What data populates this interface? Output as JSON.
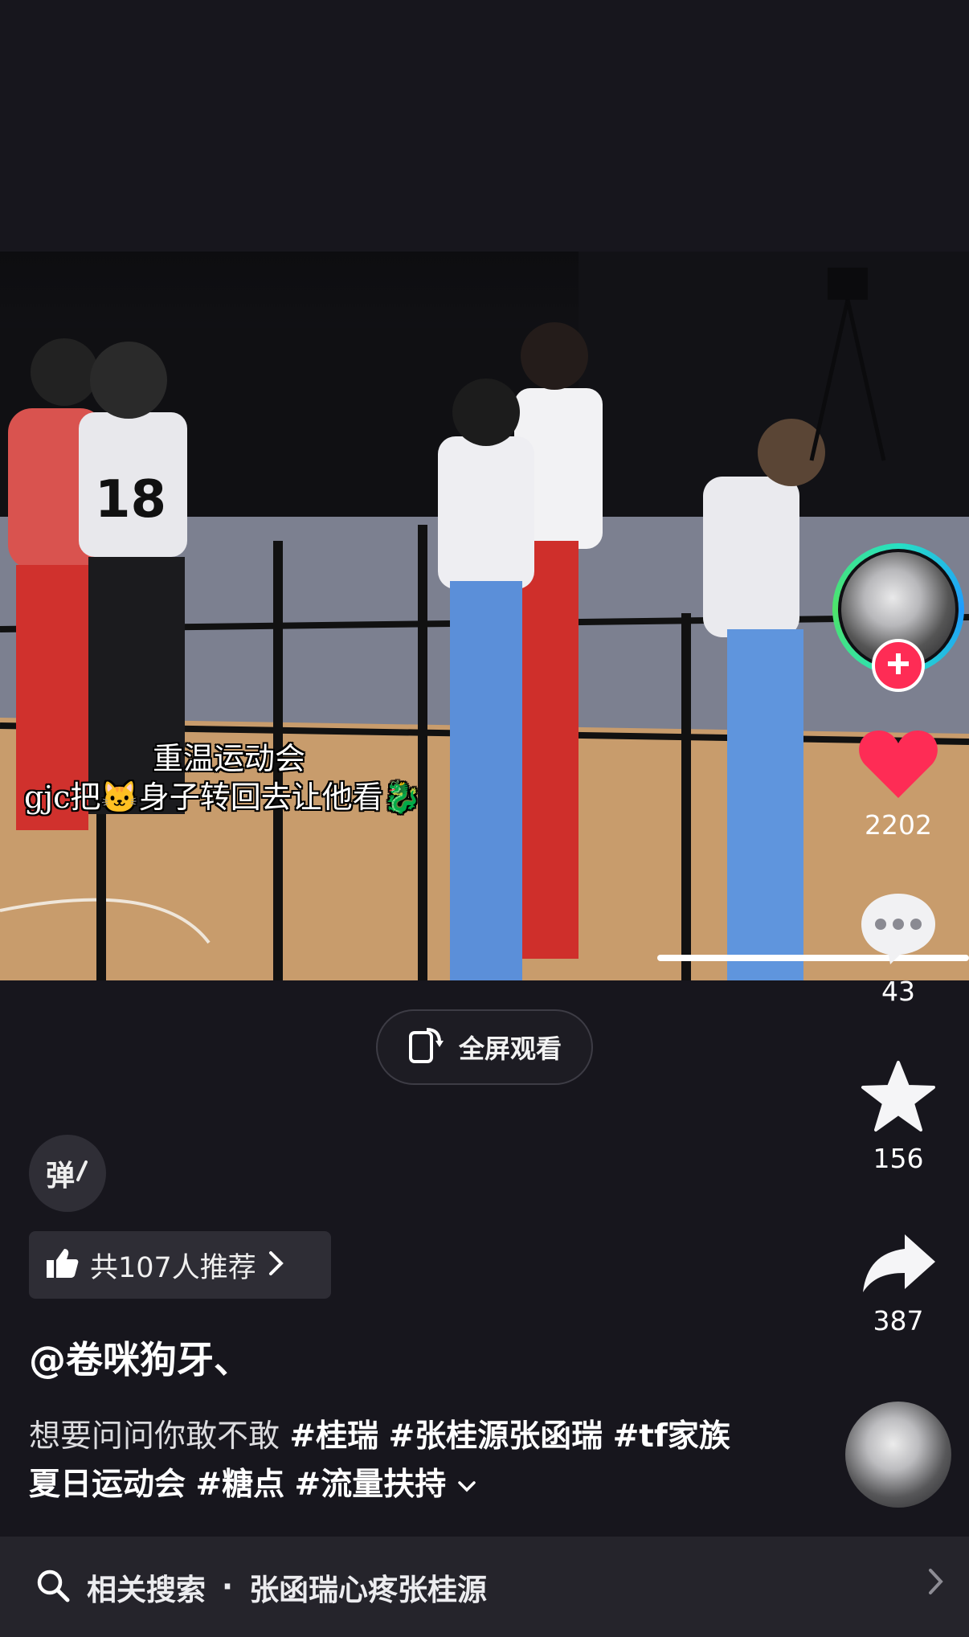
{
  "video": {
    "overlay_title": "重温运动会",
    "overlay_caption": "gjc把🐱身子转回去让他看🐉",
    "jersey_number": "18"
  },
  "fullscreen_button": {
    "label": "全屏观看"
  },
  "creator": {
    "follow_icon": "plus-icon"
  },
  "actions": {
    "likes": "2202",
    "comments": "43",
    "favorites": "156",
    "shares": "387"
  },
  "danmu": {
    "label": "弹"
  },
  "recommend": {
    "label": "共107人推荐"
  },
  "post": {
    "author": "@卷咪狗牙、",
    "description_text": "想要问问你敢不敢 ",
    "tags": [
      "#桂瑞",
      "#张桂源张函瑞",
      "#tf家族夏日运动会",
      "#糖点",
      "#流量扶持"
    ]
  },
  "related_search": {
    "prefix": "相关搜索",
    "separator": "·",
    "query": "张函瑞心疼张桂源"
  },
  "colors": {
    "like_red": "#fe2c55",
    "background": "#17161d"
  }
}
